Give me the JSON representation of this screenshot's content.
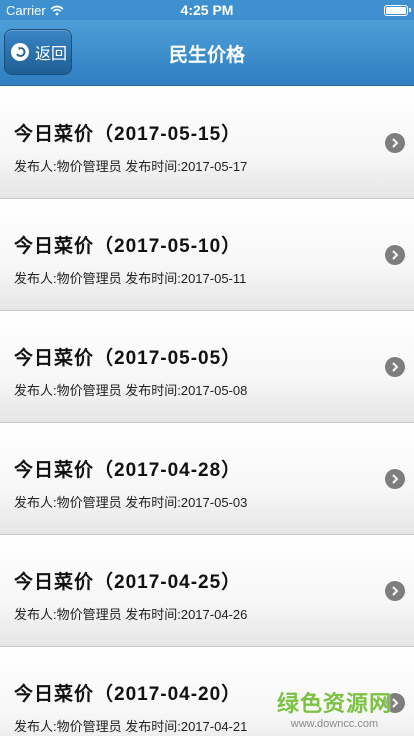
{
  "status_bar": {
    "carrier": "Carrier",
    "time": "4:25 PM"
  },
  "nav": {
    "back_label": "返回",
    "title": "民生价格"
  },
  "items": [
    {
      "title": "今日菜价（2017-05-15）",
      "meta": "发布人:物价管理员 发布时间:2017-05-17"
    },
    {
      "title": "今日菜价（2017-05-10）",
      "meta": "发布人:物价管理员 发布时间:2017-05-11"
    },
    {
      "title": "今日菜价（2017-05-05）",
      "meta": "发布人:物价管理员 发布时间:2017-05-08"
    },
    {
      "title": "今日菜价（2017-04-28）",
      "meta": "发布人:物价管理员 发布时间:2017-05-03"
    },
    {
      "title": "今日菜价（2017-04-25）",
      "meta": "发布人:物价管理员 发布时间:2017-04-26"
    },
    {
      "title": "今日菜价（2017-04-20）",
      "meta": "发布人:物价管理员 发布时间:2017-04-21"
    }
  ],
  "watermark": {
    "text": "绿色资源网",
    "url": "www.downcc.com"
  },
  "colors": {
    "nav_bar": "#3f90cf",
    "back_button": "#1f5e93",
    "chevron": "#7e7e7e",
    "watermark": "#7bc142"
  },
  "icons": {
    "back": "back-arrow-icon",
    "chevron": "chevron-right-icon",
    "wifi": "wifi-icon",
    "battery": "battery-icon"
  }
}
